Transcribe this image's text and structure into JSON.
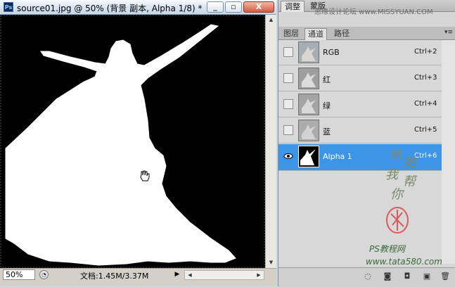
{
  "document": {
    "ps_badge": "Ps",
    "title": "source01.jpg @ 50% (背景 副本, Alpha 1/8) *",
    "minimize_label": "_",
    "restore_label": "▫",
    "close_label": "X",
    "zoom_value": "50%",
    "doc_size": "文档:1.45M/3.37M"
  },
  "panel": {
    "top_tabs": [
      "调整",
      "蒙版"
    ],
    "tabs": [
      "图层",
      "通道",
      "路径"
    ],
    "active_tab": "通道",
    "channels": [
      {
        "name": "RGB",
        "shortcut": "Ctrl+2",
        "selected": false
      },
      {
        "name": "红",
        "shortcut": "Ctrl+3",
        "selected": false
      },
      {
        "name": "绿",
        "shortcut": "Ctrl+4",
        "selected": false
      },
      {
        "name": "蓝",
        "shortcut": "Ctrl+5",
        "selected": false
      },
      {
        "name": "Alpha 1",
        "shortcut": "Ctrl+6",
        "selected": true
      }
    ]
  },
  "watermark": {
    "top": "思缘设计论坛 www.MISSYUAN.COM",
    "site": "PS教程网",
    "url": "www.tata580.com",
    "chars": [
      "他",
      "她",
      "我",
      "帮",
      "你"
    ]
  },
  "colors": {
    "selection": "#3d95e8",
    "canvas_bg": "#000000",
    "mask_white": "#ffffff"
  }
}
